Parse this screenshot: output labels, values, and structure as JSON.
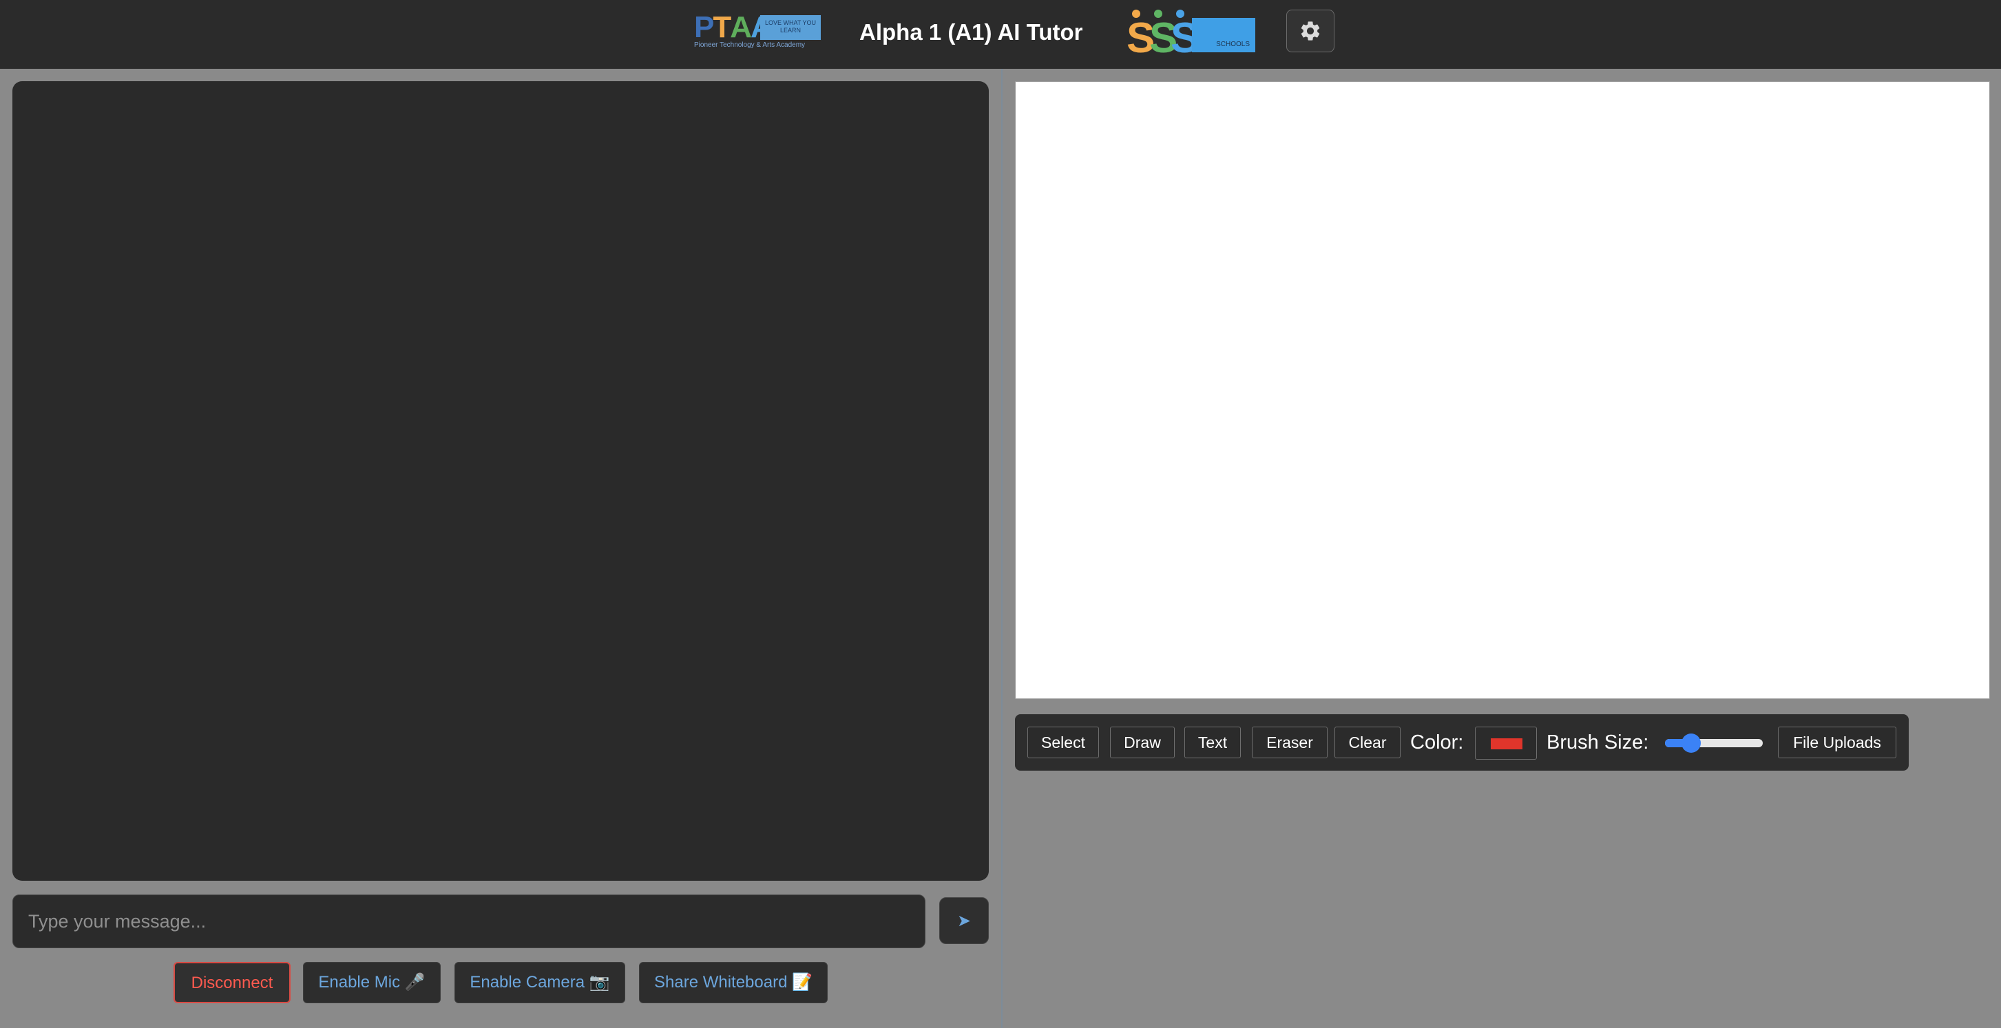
{
  "header": {
    "title": "Alpha 1 (A1) AI Tutor",
    "ptaa_logo": {
      "letters": [
        "P",
        "T",
        "A",
        "A"
      ],
      "letter_colors": [
        "#3d6fb6",
        "#f0a84a",
        "#5fae5c",
        "#4fa0de"
      ],
      "badge_text": "LOVE WHAT YOU LEARN",
      "subtitle": "Pioneer Technology & Arts Academy"
    },
    "sss_logo": {
      "letters": [
        "S",
        "S",
        "S"
      ],
      "letter_colors": [
        "#f2a94a",
        "#5fb564",
        "#4aa3e8"
      ],
      "label": "SCHOOLS"
    },
    "settings_icon": "gear-icon"
  },
  "chat": {
    "input_value": "",
    "input_placeholder": "Type your message...",
    "send_icon": "➤"
  },
  "controls": {
    "disconnect": "Disconnect",
    "enable_mic": "Enable Mic 🎤",
    "enable_camera": "Enable Camera 📷",
    "share_whiteboard": "Share Whiteboard 📝"
  },
  "whiteboard": {
    "tools": {
      "select": "Select",
      "draw": "Draw",
      "text": "Text",
      "eraser": "Eraser",
      "clear": "Clear"
    },
    "color_label": "Color:",
    "color_value": "#e0352b",
    "brush_label": "Brush Size:",
    "brush_size_fraction": 0.27,
    "file_uploads": "File Uploads"
  }
}
